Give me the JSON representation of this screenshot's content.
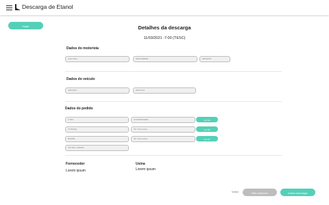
{
  "app": {
    "title": "Descarga de Etanol"
  },
  "toolbar": {
    "back_label": "Voltar"
  },
  "page": {
    "title": "Detalhes da descarga",
    "date": "11/03/2021 -7:00 (TESC)"
  },
  "motorista": {
    "title": "Dados do motorista",
    "fields": [
      "João Silva",
      "04613388590",
      "08432052"
    ]
  },
  "veiculo": {
    "title": "Dados do veículo",
    "fields": [
      "ABC4D12",
      "ABC4T34"
    ]
  },
  "pedido": {
    "title": "Dados do pedido",
    "rows": [
      {
        "left": "UTRG",
        "mid": "0745205040081",
        "button": "Ver NF"
      },
      {
        "left": "0745200g",
        "mid": "NF 0 (frs teste)",
        "button": "Ver NF"
      },
      {
        "left": "80020E",
        "mid": "NF 0 (frs teste)",
        "button": "Ver NF"
      }
    ],
    "extra": "670.000 / 545000"
  },
  "fornecedor": {
    "label": "Fornecedor",
    "value": "Lorem ipsum"
  },
  "usina": {
    "label": "Usina",
    "value": "Lorem ipsum"
  },
  "footer": {
    "back_label": "Voltar",
    "disabled_label": "Não autorizar",
    "primary_label": "Iniciar descarga"
  },
  "colors": {
    "accent": "#55d0b8",
    "disabled": "#bdbdbd"
  }
}
